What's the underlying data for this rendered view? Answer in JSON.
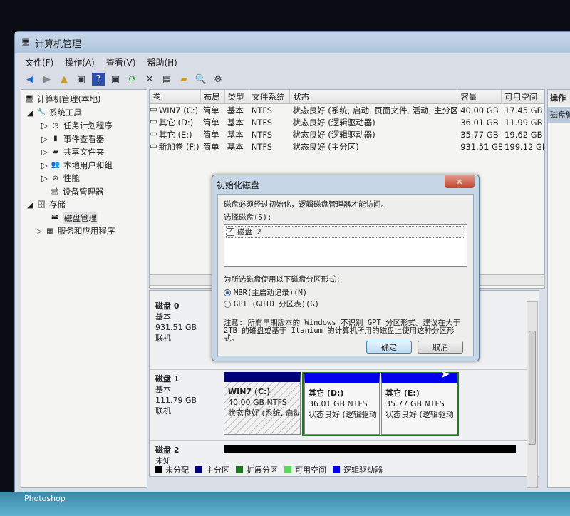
{
  "window": {
    "title": "计算机管理"
  },
  "menu": [
    "文件(F)",
    "操作(A)",
    "查看(V)",
    "帮助(H)"
  ],
  "tree": {
    "root": "计算机管理(本地)",
    "system_tools": "系统工具",
    "items": [
      "任务计划程序",
      "事件查看器",
      "共享文件夹",
      "本地用户和组",
      "性能",
      "设备管理器"
    ],
    "storage": "存储",
    "disk_mgmt": "磁盘管理",
    "services": "服务和应用程序"
  },
  "volumes": {
    "headers": [
      "卷",
      "布局",
      "类型",
      "文件系统",
      "状态",
      "容量",
      "可用空间"
    ],
    "rows": [
      [
        "WIN7 (C:)",
        "简单",
        "基本",
        "NTFS",
        "状态良好 (系统, 启动, 页面文件, 活动, 主分区)",
        "40.00 GB",
        "17.45 GB"
      ],
      [
        "其它 (D:)",
        "简单",
        "基本",
        "NTFS",
        "状态良好 (逻辑驱动器)",
        "36.01 GB",
        "11.99 GB"
      ],
      [
        "其它 (E:)",
        "简单",
        "基本",
        "NTFS",
        "状态良好 (逻辑驱动器)",
        "35.77 GB",
        "19.62 GB"
      ],
      [
        "新加卷 (F:)",
        "简单",
        "基本",
        "NTFS",
        "状态良好 (主分区)",
        "931.51 GB",
        "199.12 GB"
      ]
    ]
  },
  "action": {
    "header": "操作",
    "item": "磁盘管"
  },
  "disks": [
    {
      "name": "磁盘 0",
      "type": "基本",
      "size": "931.51 GB",
      "status": "联机"
    },
    {
      "name": "磁盘 1",
      "type": "基本",
      "size": "111.79 GB",
      "status": "联机",
      "parts": [
        {
          "name": "WIN7  (C:)",
          "size": "40.00 GB NTFS",
          "status": "状态良好 (系统, 启动"
        },
        {
          "name": "其它  (D:)",
          "size": "36.01 GB NTFS",
          "status": "状态良好 (逻辑驱动"
        },
        {
          "name": "其它  (E:)",
          "size": "35.77 GB NTFS",
          "status": "状态良好 (逻辑驱动"
        }
      ]
    },
    {
      "name": "磁盘 2",
      "type": "未知"
    }
  ],
  "legend": [
    {
      "label": "未分配",
      "color": "#000000"
    },
    {
      "label": "主分区",
      "color": "#00007a"
    },
    {
      "label": "扩展分区",
      "color": "#1f7a1f"
    },
    {
      "label": "可用空间",
      "color": "#5ad85a"
    },
    {
      "label": "逻辑驱动器",
      "color": "#0000ee"
    }
  ],
  "dialog": {
    "title": "初始化磁盘",
    "intro": "磁盘必须经过初始化，逻辑磁盘管理器才能访问。",
    "select_label": "选择磁盘(S):",
    "disk_item": "磁盘 2",
    "style_label": "为所选磁盘使用以下磁盘分区形式:",
    "mbr": "MBR(主启动记录)(M)",
    "gpt": "GPT (GUID 分区表)(G)",
    "note": "注意: 所有早期版本的 Windows 不识别 GPT 分区形式。建议在大于 2TB 的磁盘或基于 Itanium 的计算机所用的磁盘上使用这种分区形式。",
    "ok": "确定",
    "cancel": "取消"
  },
  "taskbar": {
    "label": "Photoshop"
  }
}
